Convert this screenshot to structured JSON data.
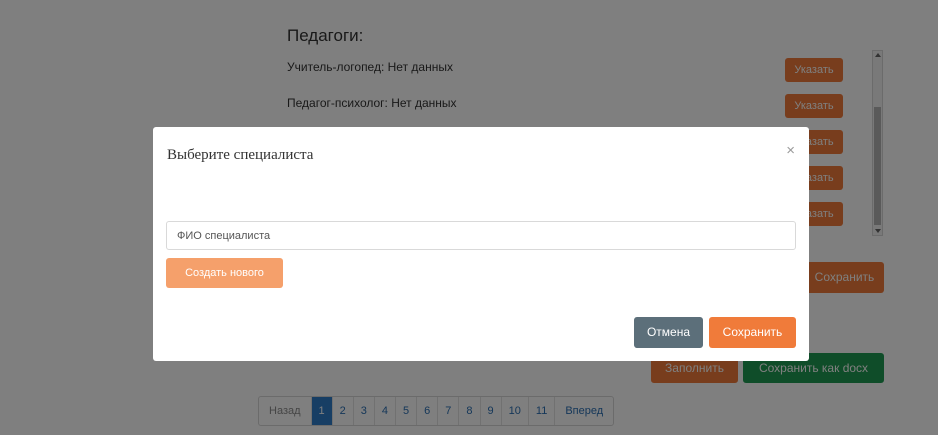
{
  "background": {
    "section_title": "Педагоги:",
    "specialists": [
      {
        "label": "Учитель-логопед: Нет данных"
      },
      {
        "label": "Педагог-психолог: Нет данных"
      }
    ],
    "indicate_label": "Указать",
    "save_label": "Сохранить",
    "fill_label": "Заполнить",
    "save_docx_label": "Сохранить как docx"
  },
  "pagination": {
    "prev_label": "Назад",
    "pages": [
      "1",
      "2",
      "3",
      "4",
      "5",
      "6",
      "7",
      "8",
      "9",
      "10",
      "11"
    ],
    "active_page": "1",
    "next_label": "Вперед"
  },
  "modal": {
    "title": "Выберите специалиста",
    "close_symbol": "×",
    "fio_placeholder": "ФИО специалиста",
    "fio_value": "",
    "create_label": "Создать нового",
    "cancel_label": "Отмена",
    "save_label": "Сохранить"
  },
  "colors": {
    "accent_orange": "#f07b3a",
    "light_orange": "#f5a06b",
    "cancel_gray": "#5c6f7a",
    "docx_green": "#1f9a52",
    "pagination_active": "#2e7cc9"
  }
}
